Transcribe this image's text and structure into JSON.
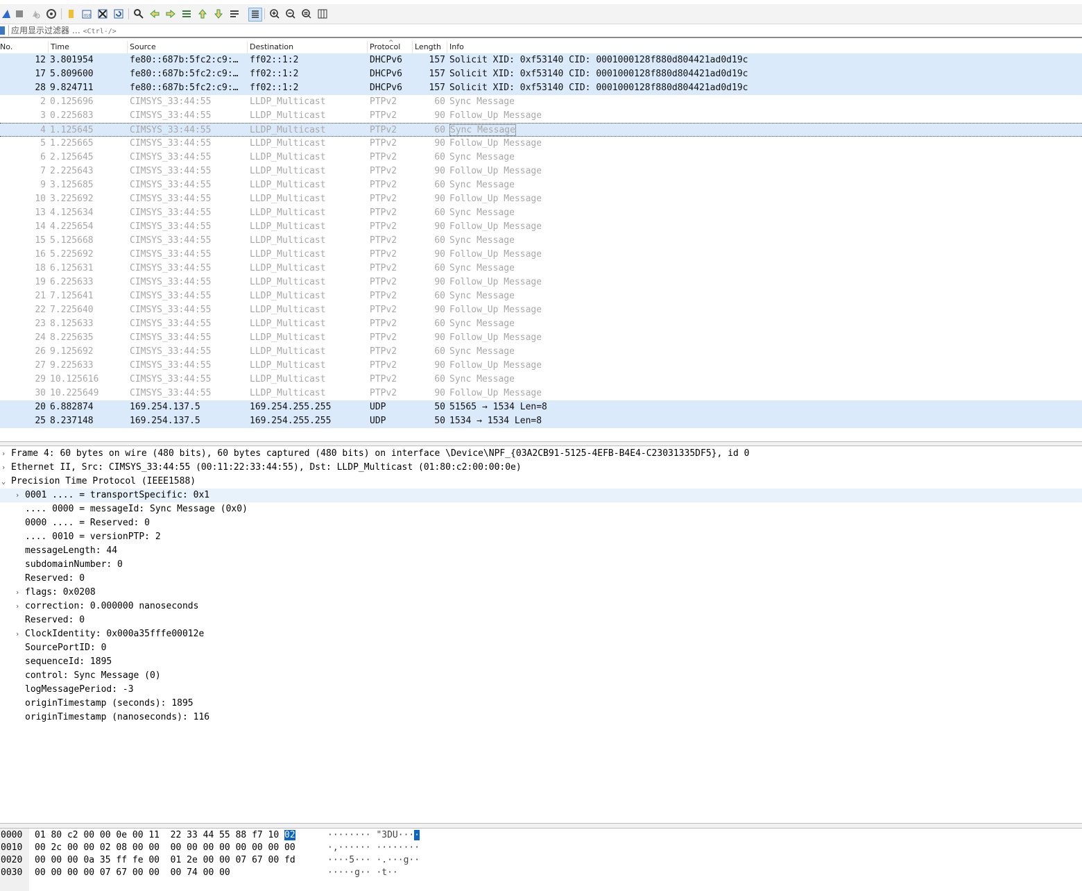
{
  "filter": {
    "placeholder": "应用显示过滤器 … ",
    "hint": "<Ctrl-/>"
  },
  "toolbar_icons": [
    "shark-fin-start-icon",
    "stop-icon",
    "restart-icon",
    "options-gear-icon",
    "open-file-icon",
    "save-file-icon",
    "close-file-icon",
    "reload-icon",
    "find-icon",
    "back-arrow-icon",
    "forward-arrow-icon",
    "goto-packet-icon",
    "first-packet-icon",
    "last-packet-icon",
    "autoscroll-icon",
    "colorize-icon",
    "zoom-in-icon",
    "zoom-out-icon",
    "zoom-normal-icon",
    "resize-columns-icon"
  ],
  "columns": {
    "no": "No.",
    "time": "Time",
    "source": "Source",
    "destination": "Destination",
    "protocol": "Protocol",
    "length": "Length",
    "info": "Info"
  },
  "packets": [
    {
      "no": "12",
      "time": "3.801954",
      "src": "fe80::687b:5fc2:c9:…",
      "dst": "ff02::1:2",
      "proto": "DHCPv6",
      "len": "157",
      "info": "Solicit XID: 0xf53140 CID: 0001000128f880d804421ad0d19c",
      "style": "blue"
    },
    {
      "no": "17",
      "time": "5.809600",
      "src": "fe80::687b:5fc2:c9:…",
      "dst": "ff02::1:2",
      "proto": "DHCPv6",
      "len": "157",
      "info": "Solicit XID: 0xf53140 CID: 0001000128f880d804421ad0d19c",
      "style": "blue"
    },
    {
      "no": "28",
      "time": "9.824711",
      "src": "fe80::687b:5fc2:c9:…",
      "dst": "ff02::1:2",
      "proto": "DHCPv6",
      "len": "157",
      "info": "Solicit XID: 0xf53140 CID: 0001000128f880d804421ad0d19c",
      "style": "blue"
    },
    {
      "no": "2",
      "time": "0.125696",
      "src": "CIMSYS_33:44:55",
      "dst": "LLDP_Multicast",
      "proto": "PTPv2",
      "len": "60",
      "info": "Sync Message",
      "style": "grey"
    },
    {
      "no": "3",
      "time": "0.225683",
      "src": "CIMSYS_33:44:55",
      "dst": "LLDP_Multicast",
      "proto": "PTPv2",
      "len": "90",
      "info": "Follow_Up Message",
      "style": "grey"
    },
    {
      "no": "4",
      "time": "1.125645",
      "src": "CIMSYS_33:44:55",
      "dst": "LLDP_Multicast",
      "proto": "PTPv2",
      "len": "60",
      "info": "Sync Message",
      "style": "sel"
    },
    {
      "no": "5",
      "time": "1.225665",
      "src": "CIMSYS_33:44:55",
      "dst": "LLDP_Multicast",
      "proto": "PTPv2",
      "len": "90",
      "info": "Follow_Up Message",
      "style": "grey"
    },
    {
      "no": "6",
      "time": "2.125645",
      "src": "CIMSYS_33:44:55",
      "dst": "LLDP_Multicast",
      "proto": "PTPv2",
      "len": "60",
      "info": "Sync Message",
      "style": "grey"
    },
    {
      "no": "7",
      "time": "2.225643",
      "src": "CIMSYS_33:44:55",
      "dst": "LLDP_Multicast",
      "proto": "PTPv2",
      "len": "90",
      "info": "Follow_Up Message",
      "style": "grey"
    },
    {
      "no": "9",
      "time": "3.125685",
      "src": "CIMSYS_33:44:55",
      "dst": "LLDP_Multicast",
      "proto": "PTPv2",
      "len": "60",
      "info": "Sync Message",
      "style": "grey"
    },
    {
      "no": "10",
      "time": "3.225692",
      "src": "CIMSYS_33:44:55",
      "dst": "LLDP_Multicast",
      "proto": "PTPv2",
      "len": "90",
      "info": "Follow_Up Message",
      "style": "grey"
    },
    {
      "no": "13",
      "time": "4.125634",
      "src": "CIMSYS_33:44:55",
      "dst": "LLDP_Multicast",
      "proto": "PTPv2",
      "len": "60",
      "info": "Sync Message",
      "style": "grey"
    },
    {
      "no": "14",
      "time": "4.225654",
      "src": "CIMSYS_33:44:55",
      "dst": "LLDP_Multicast",
      "proto": "PTPv2",
      "len": "90",
      "info": "Follow_Up Message",
      "style": "grey"
    },
    {
      "no": "15",
      "time": "5.125668",
      "src": "CIMSYS_33:44:55",
      "dst": "LLDP_Multicast",
      "proto": "PTPv2",
      "len": "60",
      "info": "Sync Message",
      "style": "grey"
    },
    {
      "no": "16",
      "time": "5.225692",
      "src": "CIMSYS_33:44:55",
      "dst": "LLDP_Multicast",
      "proto": "PTPv2",
      "len": "90",
      "info": "Follow_Up Message",
      "style": "grey"
    },
    {
      "no": "18",
      "time": "6.125631",
      "src": "CIMSYS_33:44:55",
      "dst": "LLDP_Multicast",
      "proto": "PTPv2",
      "len": "60",
      "info": "Sync Message",
      "style": "grey"
    },
    {
      "no": "19",
      "time": "6.225633",
      "src": "CIMSYS_33:44:55",
      "dst": "LLDP_Multicast",
      "proto": "PTPv2",
      "len": "90",
      "info": "Follow_Up Message",
      "style": "grey"
    },
    {
      "no": "21",
      "time": "7.125641",
      "src": "CIMSYS_33:44:55",
      "dst": "LLDP_Multicast",
      "proto": "PTPv2",
      "len": "60",
      "info": "Sync Message",
      "style": "grey"
    },
    {
      "no": "22",
      "time": "7.225640",
      "src": "CIMSYS_33:44:55",
      "dst": "LLDP_Multicast",
      "proto": "PTPv2",
      "len": "90",
      "info": "Follow_Up Message",
      "style": "grey"
    },
    {
      "no": "23",
      "time": "8.125633",
      "src": "CIMSYS_33:44:55",
      "dst": "LLDP_Multicast",
      "proto": "PTPv2",
      "len": "60",
      "info": "Sync Message",
      "style": "grey"
    },
    {
      "no": "24",
      "time": "8.225635",
      "src": "CIMSYS_33:44:55",
      "dst": "LLDP_Multicast",
      "proto": "PTPv2",
      "len": "90",
      "info": "Follow_Up Message",
      "style": "grey"
    },
    {
      "no": "26",
      "time": "9.125692",
      "src": "CIMSYS_33:44:55",
      "dst": "LLDP_Multicast",
      "proto": "PTPv2",
      "len": "60",
      "info": "Sync Message",
      "style": "grey"
    },
    {
      "no": "27",
      "time": "9.225633",
      "src": "CIMSYS_33:44:55",
      "dst": "LLDP_Multicast",
      "proto": "PTPv2",
      "len": "90",
      "info": "Follow_Up Message",
      "style": "grey"
    },
    {
      "no": "29",
      "time": "10.125616",
      "src": "CIMSYS_33:44:55",
      "dst": "LLDP_Multicast",
      "proto": "PTPv2",
      "len": "60",
      "info": "Sync Message",
      "style": "grey"
    },
    {
      "no": "30",
      "time": "10.225649",
      "src": "CIMSYS_33:44:55",
      "dst": "LLDP_Multicast",
      "proto": "PTPv2",
      "len": "90",
      "info": "Follow_Up Message",
      "style": "grey"
    },
    {
      "no": "20",
      "time": "6.882874",
      "src": "169.254.137.5",
      "dst": "169.254.255.255",
      "proto": "UDP",
      "len": "50",
      "info": "51565 → 1534 Len=8",
      "style": "blue"
    },
    {
      "no": "25",
      "time": "8.237148",
      "src": "169.254.137.5",
      "dst": "169.254.255.255",
      "proto": "UDP",
      "len": "50",
      "info": "1534 → 1534 Len=8",
      "style": "blue"
    }
  ],
  "details": [
    {
      "text": "Frame 4: 60 bytes on wire (480 bits), 60 bytes captured (480 bits) on interface \\Device\\NPF_{03A2CB91-5125-4EFB-B4E4-C23031335DF5}, id 0",
      "level": 0,
      "arrow": "collapsed"
    },
    {
      "text": "Ethernet II, Src: CIMSYS_33:44:55 (00:11:22:33:44:55), Dst: LLDP_Multicast (01:80:c2:00:00:0e)",
      "level": 0,
      "arrow": "collapsed"
    },
    {
      "text": "Precision Time Protocol (IEEE1588)",
      "level": 0,
      "arrow": "expanded"
    },
    {
      "text": "0001 .... = transportSpecific: 0x1",
      "level": 1,
      "arrow": "collapsed",
      "hl": true
    },
    {
      "text": ".... 0000 = messageId: Sync Message (0x0)",
      "level": 1,
      "arrow": "none"
    },
    {
      "text": "0000 .... = Reserved: 0",
      "level": 1,
      "arrow": "none"
    },
    {
      "text": ".... 0010 = versionPTP: 2",
      "level": 1,
      "arrow": "none"
    },
    {
      "text": "messageLength: 44",
      "level": 1,
      "arrow": "none"
    },
    {
      "text": "subdomainNumber: 0",
      "level": 1,
      "arrow": "none"
    },
    {
      "text": "Reserved: 0",
      "level": 1,
      "arrow": "none"
    },
    {
      "text": "flags: 0x0208",
      "level": 1,
      "arrow": "collapsed"
    },
    {
      "text": "correction: 0.000000 nanoseconds",
      "level": 1,
      "arrow": "collapsed"
    },
    {
      "text": "Reserved: 0",
      "level": 1,
      "arrow": "none"
    },
    {
      "text": "ClockIdentity: 0x000a35fffe00012e",
      "level": 1,
      "arrow": "collapsed"
    },
    {
      "text": "SourcePortID: 0",
      "level": 1,
      "arrow": "none"
    },
    {
      "text": "sequenceId: 1895",
      "level": 1,
      "arrow": "none"
    },
    {
      "text": "control: Sync Message (0)",
      "level": 1,
      "arrow": "none"
    },
    {
      "text": "logMessagePeriod: -3",
      "level": 1,
      "arrow": "none"
    },
    {
      "text": "originTimestamp (seconds): 1895",
      "level": 1,
      "arrow": "none"
    },
    {
      "text": "originTimestamp (nanoseconds): 116",
      "level": 1,
      "arrow": "none"
    }
  ],
  "bytes": [
    {
      "offset": "0000",
      "hex_a": "01 80 c2 00 00 0e 00 11  22 33 44 55 88 f7 10 ",
      "hex_sel": "02",
      "ascii_a": "········ \"3DU···",
      "ascii_sel": "·"
    },
    {
      "offset": "0010",
      "hex_a": "00 2c 00 00 02 08 00 00  00 00 00 00 00 00 00 00",
      "hex_sel": "",
      "ascii_a": "·,······ ········",
      "ascii_sel": ""
    },
    {
      "offset": "0020",
      "hex_a": "00 00 00 0a 35 ff fe 00  01 2e 00 00 07 67 00 fd",
      "hex_sel": "",
      "ascii_a": "····5··· ·.···g··",
      "ascii_sel": ""
    },
    {
      "offset": "0030",
      "hex_a": "00 00 00 00 07 67 00 00  00 74 00 00",
      "hex_sel": "",
      "ascii_a": "·····g·· ·t··",
      "ascii_sel": ""
    }
  ],
  "colors": {
    "row_blue": "#daeafa",
    "row_grey_text": "#a8a8a8",
    "byte_select": "#0a64c8"
  }
}
